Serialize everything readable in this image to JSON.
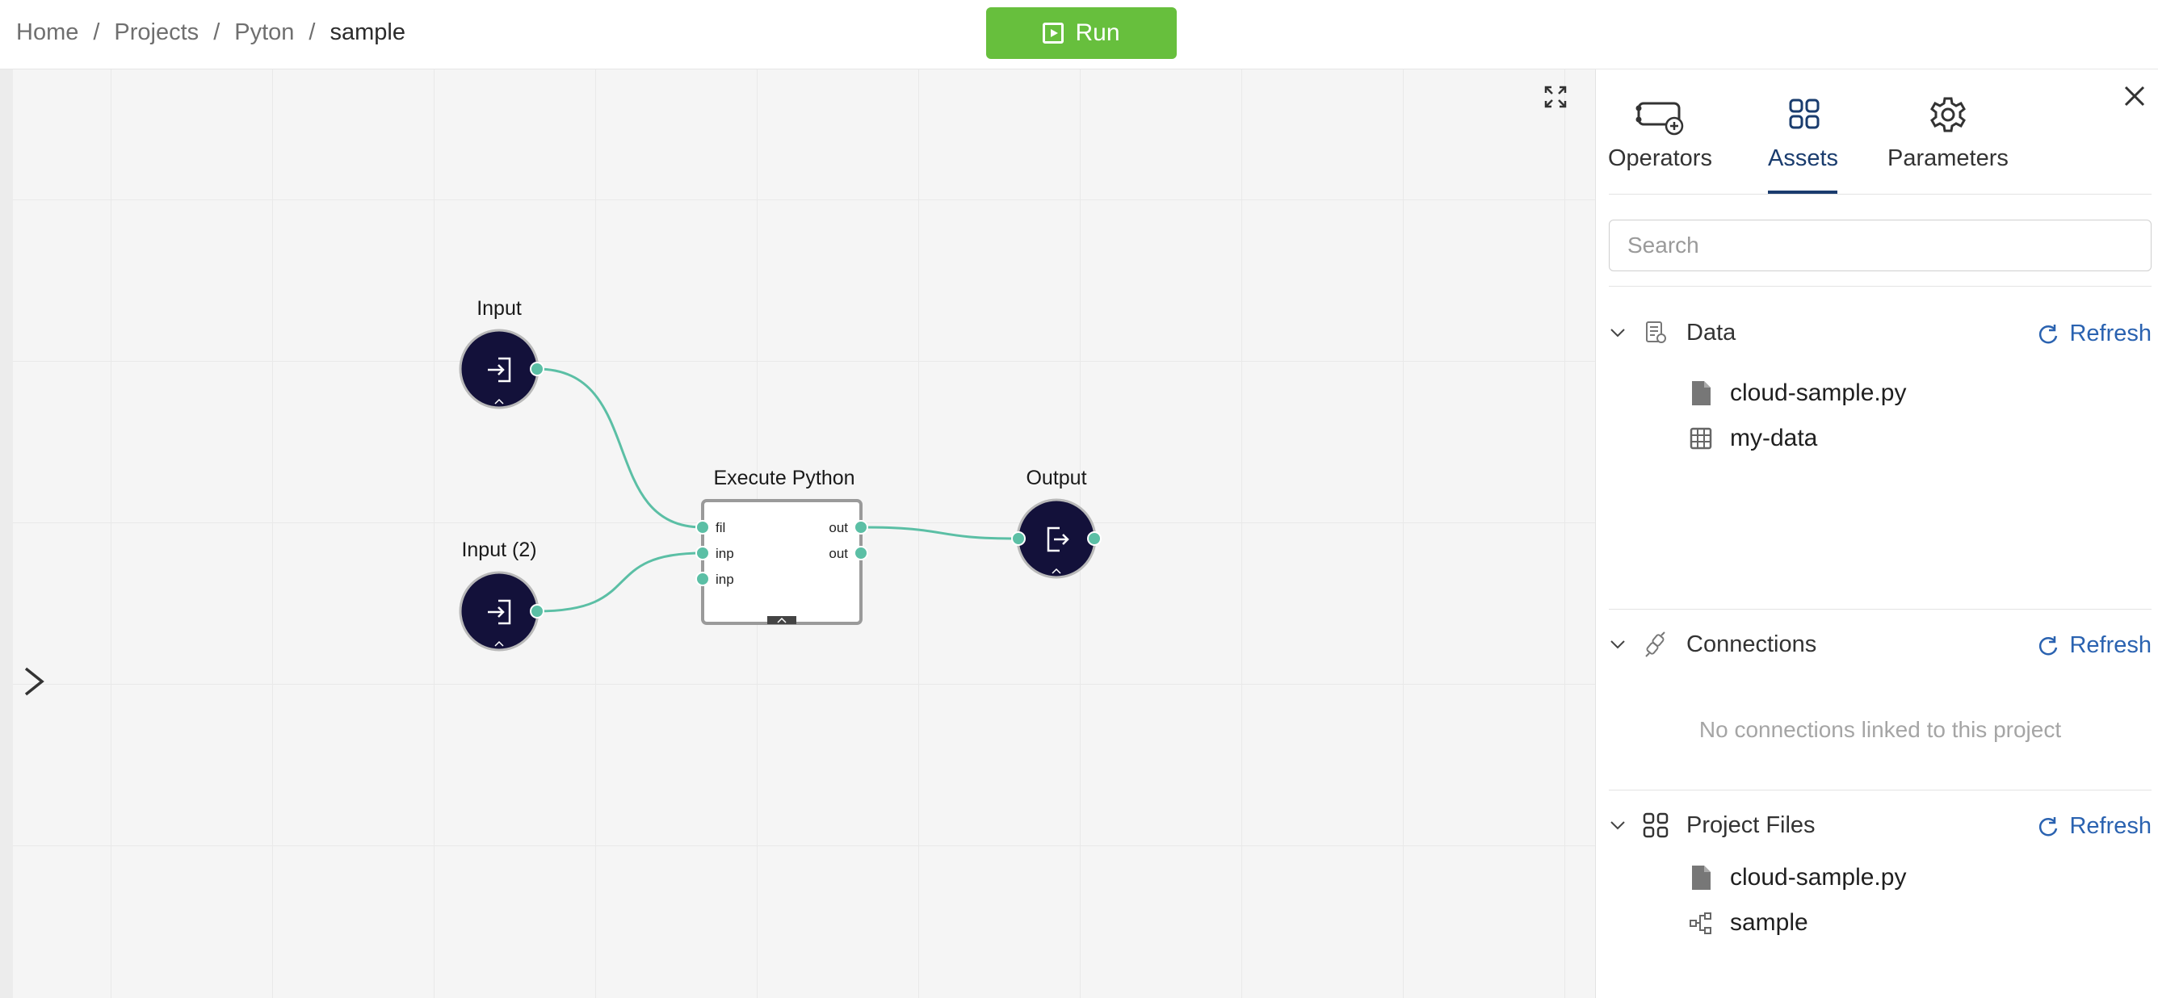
{
  "breadcrumb": {
    "items": [
      "Home",
      "Projects",
      "Pyton"
    ],
    "current": "sample",
    "separator": "/"
  },
  "toolbar": {
    "run_label": "Run"
  },
  "canvas": {
    "nodes": {
      "input1": {
        "label": "Input"
      },
      "input2": {
        "label": "Input (2)"
      },
      "execute": {
        "label": "Execute Python",
        "ports_in": [
          "fil",
          "inp",
          "inp"
        ],
        "ports_out": [
          "out",
          "out"
        ]
      },
      "output": {
        "label": "Output"
      }
    }
  },
  "panel": {
    "tabs": [
      {
        "label": "Operators",
        "icon": "operators-icon"
      },
      {
        "label": "Assets",
        "icon": "assets-grid-icon",
        "active": true
      },
      {
        "label": "Parameters",
        "icon": "gear-icon"
      }
    ],
    "search": {
      "placeholder": "Search",
      "value": ""
    },
    "sections": {
      "data": {
        "title": "Data",
        "refresh_label": "Refresh",
        "items": [
          {
            "label": "cloud-sample.py",
            "icon": "file-icon"
          },
          {
            "label": "my-data",
            "icon": "table-icon"
          }
        ]
      },
      "connections": {
        "title": "Connections",
        "refresh_label": "Refresh",
        "empty_message": "No connections linked to this project"
      },
      "project_files": {
        "title": "Project Files",
        "refresh_label": "Refresh",
        "items": [
          {
            "label": "cloud-sample.py",
            "icon": "file-icon"
          },
          {
            "label": "sample",
            "icon": "flow-icon"
          }
        ]
      }
    }
  },
  "colors": {
    "run": "#67bf3d",
    "node_fill": "#13113a",
    "port": "#5bbfa5",
    "accent": "#1a3c6e",
    "link": "#2a62b0"
  }
}
